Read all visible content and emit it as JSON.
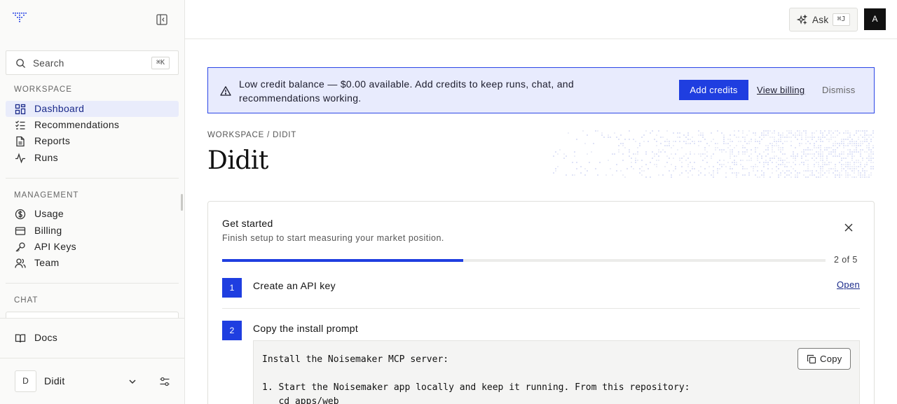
{
  "sidebar": {
    "search": {
      "label": "Search",
      "shortcut": "⌘K"
    },
    "sections": {
      "workspace": "WORKSPACE",
      "management": "MANAGEMENT",
      "chat": "CHAT"
    },
    "workspace_items": [
      {
        "label": "Dashboard",
        "icon": "dashboard-icon",
        "active": true
      },
      {
        "label": "Recommendations",
        "icon": "checklist-icon"
      },
      {
        "label": "Reports",
        "icon": "document-icon"
      },
      {
        "label": "Runs",
        "icon": "activity-icon"
      }
    ],
    "management_items": [
      {
        "label": "Usage",
        "icon": "dollar-circle-icon"
      },
      {
        "label": "Billing",
        "icon": "credit-card-icon"
      },
      {
        "label": "API Keys",
        "icon": "key-icon"
      },
      {
        "label": "Team",
        "icon": "users-icon"
      }
    ],
    "docs": {
      "label": "Docs",
      "icon": "book-icon"
    },
    "user": {
      "initial": "D",
      "name": "Didit"
    }
  },
  "topbar": {
    "ask": {
      "label": "Ask",
      "shortcut": "⌘J"
    },
    "avatar_initial": "A"
  },
  "banner": {
    "text": "Low credit balance — $0.00 available. Add credits to keep runs, chat, and recommendations working.",
    "add_credits": "Add credits",
    "view_billing": "View billing",
    "dismiss": "Dismiss",
    "accent": "#1f3ee0"
  },
  "header": {
    "breadcrumb": "WORKSPACE / DIDIT",
    "title": "Didit"
  },
  "get_started": {
    "title": "Get started",
    "subtitle": "Finish setup to start measuring your market position.",
    "progress": {
      "completed": 2,
      "total": 5,
      "label": "2 of 5"
    },
    "steps": [
      {
        "number": "1",
        "title": "Create an API key",
        "action": "Open"
      },
      {
        "number": "2",
        "title": "Copy the install prompt"
      }
    ],
    "code": "Install the Noisemaker MCP server:\n\n1. Start the Noisemaker app locally and keep it running. From this repository:\n   cd apps/web",
    "copy_label": "Copy"
  }
}
